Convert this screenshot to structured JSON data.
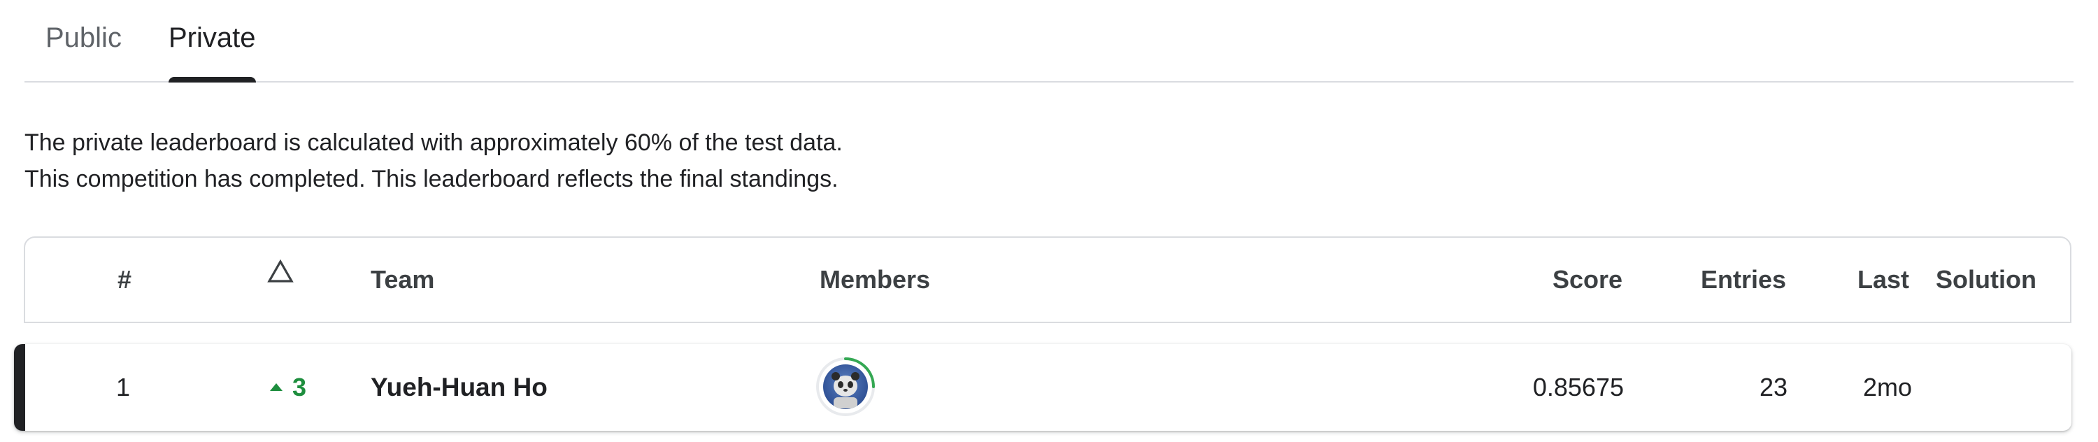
{
  "tabs": [
    {
      "label": "Public",
      "active": false
    },
    {
      "label": "Private",
      "active": true
    }
  ],
  "description": {
    "line1": "The private leaderboard is calculated with approximately 60% of the test data.",
    "line2": "This competition has completed. This leaderboard reflects the final standings."
  },
  "table": {
    "headers": {
      "rank": "#",
      "change_icon": "delta-triangle-icon",
      "team": "Team",
      "members": "Members",
      "score": "Score",
      "entries": "Entries",
      "last": "Last",
      "solution": "Solution"
    },
    "rows": [
      {
        "rank": "1",
        "change": "3",
        "change_direction": "up",
        "team": "Yueh-Huan Ho",
        "members_icon": "member-avatar",
        "score": "0.85675",
        "entries": "23",
        "last": "2mo",
        "solution": ""
      }
    ]
  },
  "colors": {
    "positive": "#1e8e3e",
    "text": "#202124",
    "border": "#dadce0",
    "row_indicator": "#202124"
  }
}
